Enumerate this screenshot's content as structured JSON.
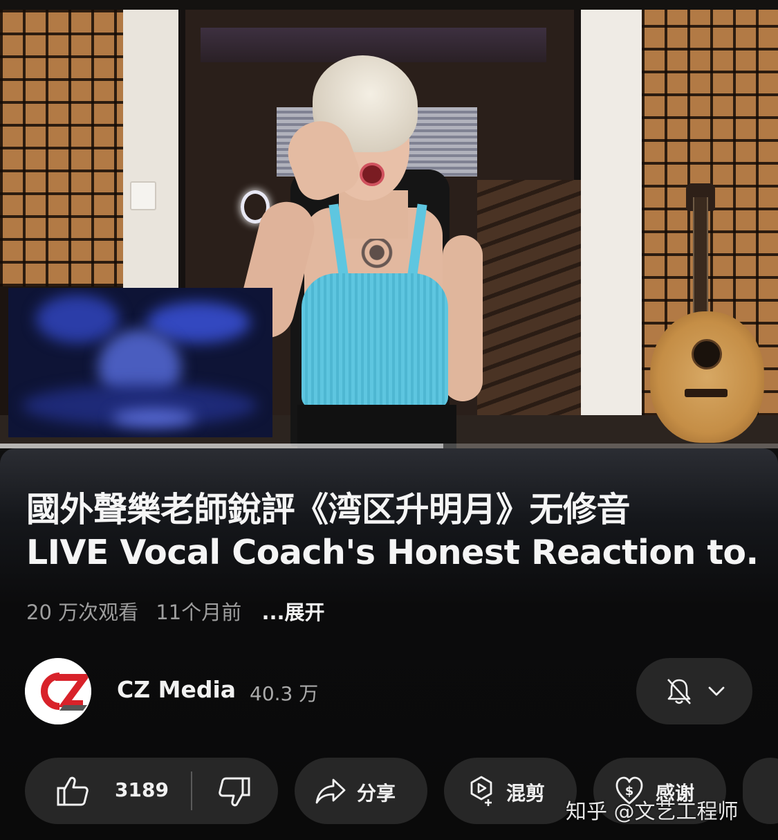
{
  "video": {
    "progress_fraction": 0.57
  },
  "title": {
    "line1": "國外聲樂老師銳評《湾区升明月》无修音",
    "line2": "LIVE Vocal Coach's Honest Reaction to..."
  },
  "meta": {
    "views": "20 万次观看",
    "time_ago": "11个月前",
    "expand_label": "...展开"
  },
  "channel": {
    "name": "CZ Media",
    "subscribers": "40.3 万",
    "avatar_text": "CZ"
  },
  "actions": {
    "like_count": "3189",
    "share_label": "分享",
    "remix_label": "混剪",
    "thanks_label": "感谢"
  },
  "watermark": "知乎 @文艺工程师",
  "colors": {
    "background": "#0f0f0f",
    "pill": "#272727",
    "avatar_red": "#d8222a",
    "text_secondary": "#9e9e9e"
  },
  "icons": [
    "like-icon",
    "dislike-icon",
    "share-icon",
    "remix-icon",
    "thanks-icon",
    "bell-off-icon",
    "chevron-down-icon"
  ]
}
